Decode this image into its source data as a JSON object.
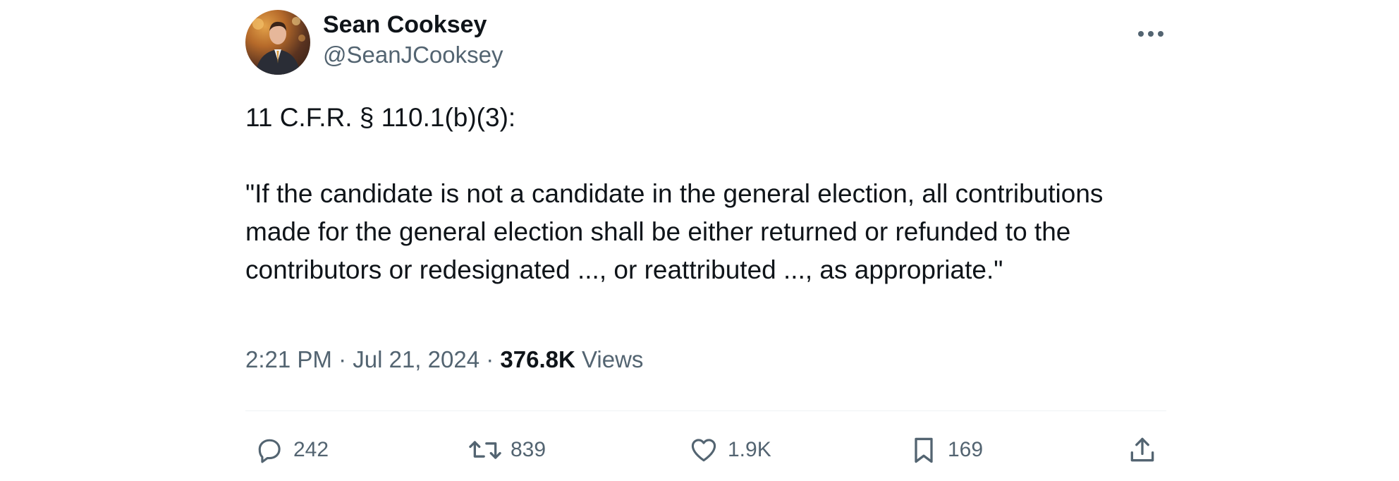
{
  "author": {
    "display_name": "Sean Cooksey",
    "handle": "@SeanJCooksey"
  },
  "tweet": {
    "text": "11 C.F.R. § 110.1(b)(3):\n\n\"If the candidate is not a candidate in the general election, all contributions made for the general election shall be either returned or refunded to the contributors or redesignated ..., or reattributed ..., as appropriate.\"",
    "time": "2:21 PM",
    "separator": "·",
    "date": "Jul 21, 2024",
    "views_count": "376.8K",
    "views_label": "Views"
  },
  "actions": {
    "replies": "242",
    "reposts": "839",
    "likes": "1.9K",
    "bookmarks": "169"
  },
  "icons": {
    "more": "more-horizontal-icon",
    "reply": "reply-bubble-icon",
    "repost": "repost-arrows-icon",
    "like": "heart-icon",
    "bookmark": "bookmark-icon",
    "share": "share-upload-icon"
  },
  "colors": {
    "text_primary": "#0f1419",
    "text_secondary": "#536471",
    "divider": "#eff3f4"
  }
}
